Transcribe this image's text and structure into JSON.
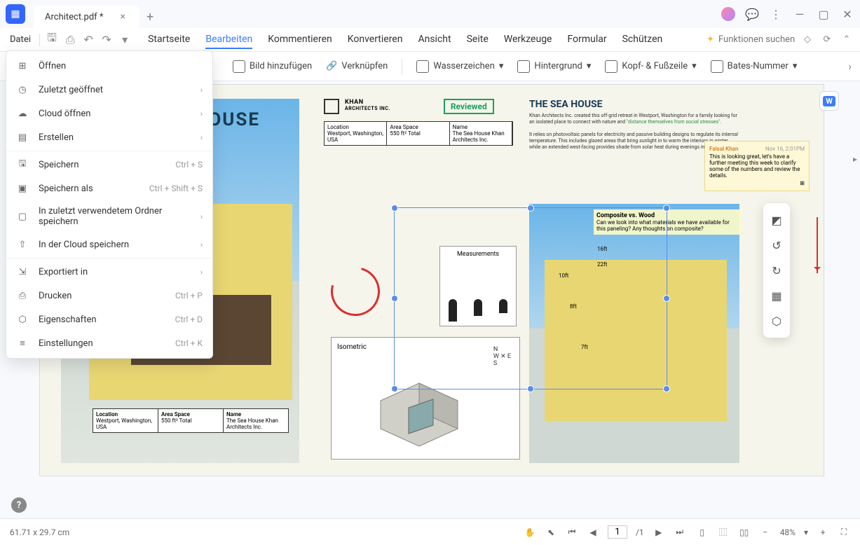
{
  "titlebar": {
    "tab_title": "Architect.pdf *"
  },
  "menubar": {
    "file": "Datei",
    "search_placeholder": "Funktionen suchen"
  },
  "tabs": [
    "Startseite",
    "Bearbeiten",
    "Kommentieren",
    "Konvertieren",
    "Ansicht",
    "Seite",
    "Werkzeuge",
    "Formular",
    "Schützen"
  ],
  "toolbar": {
    "image": "Bild hinzufügen",
    "link": "Verknüpfen",
    "watermark": "Wasserzeichen",
    "background": "Hintergrund",
    "headerfooter": "Kopf- & Fußzeile",
    "bates": "Bates-Nummer"
  },
  "file_menu": {
    "open": "Öffnen",
    "recent": "Zuletzt geöffnet",
    "cloud_open": "Cloud öffnen",
    "create": "Erstellen",
    "save": "Speichern",
    "save_sc": "Ctrl + S",
    "saveas": "Speichern als",
    "saveas_sc": "Ctrl + Shift + S",
    "recentfolder": "In zuletzt verwendetem Ordner speichern",
    "cloud_save": "In der Cloud speichern",
    "export": "Exportiert in",
    "print": "Drucken",
    "print_sc": "Ctrl + P",
    "props": "Eigenschaften",
    "props_sc": "Ctrl + D",
    "settings": "Einstellungen",
    "settings_sc": "Ctrl + K"
  },
  "doc": {
    "house_title": "HOUSE",
    "reviewed": "Reviewed",
    "sea_title": "THE SEA HOUSE",
    "logo_name": "KHAN",
    "logo_sub": "ARCHITECTS INC.",
    "t1": {
      "h1": "Location",
      "v1": "Westport,\nWashington, USA",
      "h2": "Area Space",
      "v2": "550 ft²\nTotal",
      "h3": "Name",
      "v3": "The Sea House\nKhan Architects Inc."
    },
    "meas": "Measurements",
    "iso": "Isometric",
    "desc1": "Khan Architects Inc. created this off-grid retreat in Westport, Washington for a family looking for an isolated place to connect with nature and ",
    "desc_hl": "\"distance themselves from social stresses\"",
    "desc2": "It relies on photovoltaic panels for electricity and passive building designs to regulate its internal temperature. This includes glazed areas that bring sunlight in to warm the interiors in winter, while an extended west-facing provides shade from solar heat during evenings in the summer.",
    "comp_title": "Composite vs. Wood",
    "comp_body": "Can we look into what materials we have available for this paneling? Any thoughts on composite?",
    "ft_label": [
      "16ft",
      "22ft",
      "10ft",
      "8ft",
      "7ft"
    ],
    "note": {
      "name": "Faisal Khan",
      "date": "Nov 16, 2:01PM",
      "body": "This is looking great, let's have a further meeting this week to clarify some of the numbers and review the details."
    }
  },
  "status": {
    "dims": "61.71 x 29.7 cm",
    "page": "1",
    "total": "/1",
    "zoom": "48%"
  },
  "word": "W"
}
